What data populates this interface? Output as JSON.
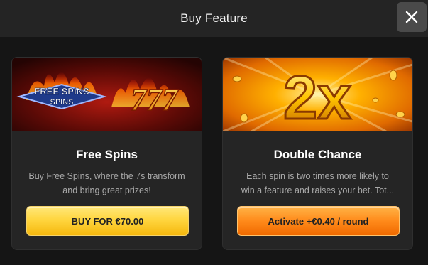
{
  "header": {
    "title": "Buy Feature"
  },
  "close": {
    "icon": "close-icon"
  },
  "cards": [
    {
      "title": "Free Spins",
      "desc_line1": "Buy Free Spins, where the 7s transform",
      "desc_line2": "and bring great prizes!",
      "button_label": "BUY FOR €70.00",
      "banner_text": "FREE SPINS",
      "banner_sevens": "777"
    },
    {
      "title": "Double Chance",
      "desc_line1": "Each spin is two times more likely to",
      "desc_line2": "win a feature and raises your bet. Tot...",
      "button_label": "Activate +€0.40 / round",
      "banner_text": "2x"
    }
  ],
  "colors": {
    "background": "#151515",
    "header": "#242424",
    "card": "#252525",
    "yellow_button": "#ffd63f",
    "orange_button": "#ff8a1a"
  }
}
